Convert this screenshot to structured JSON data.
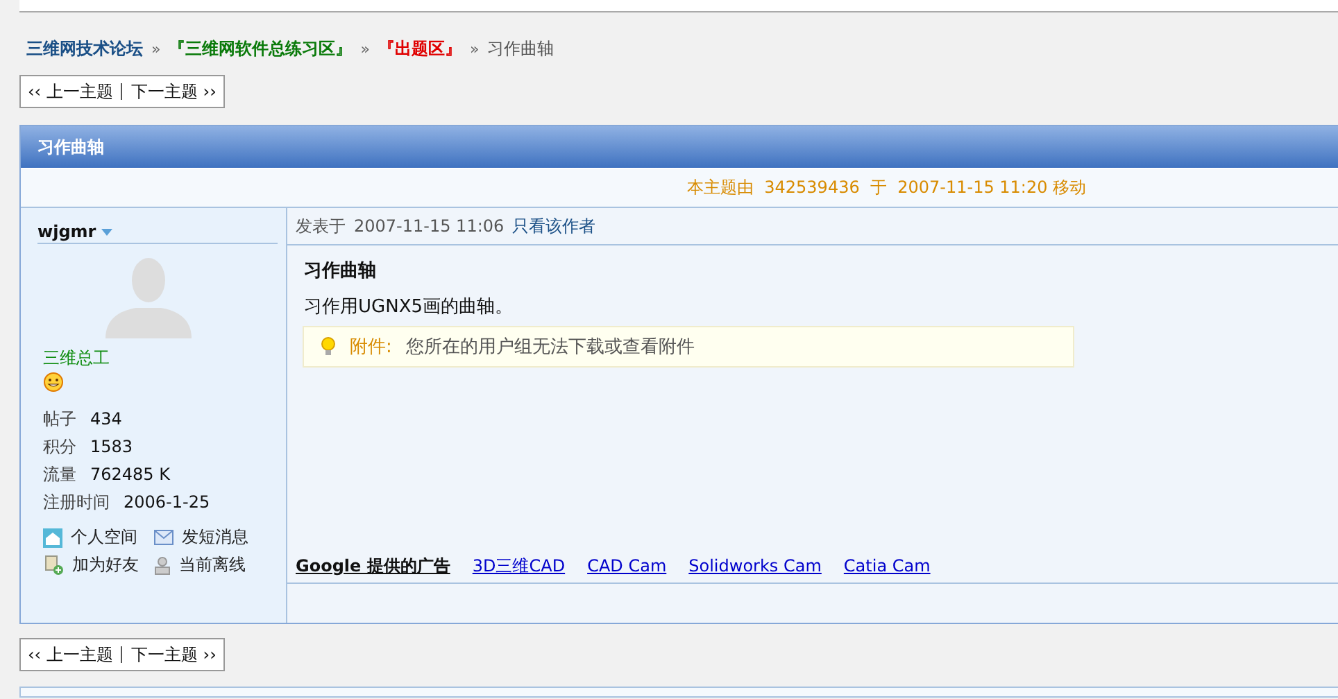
{
  "breadcrumb": [
    {
      "label": "三维网技术论坛",
      "color": "#1a4f86"
    },
    {
      "label": "『三维网软件总练习区』",
      "color": "#0a7a0a"
    },
    {
      "label": "『出题区』",
      "color": "#e00000"
    },
    {
      "label": "习作曲轴",
      "color": "#555555"
    }
  ],
  "breadcrumb_separator": "»",
  "thread_nav": {
    "prev": "上一主题",
    "next": "下一主题",
    "prev_arrow": "‹‹",
    "next_arrow": "››"
  },
  "thread_nav_bottom": {
    "prev": "上一主题",
    "next": "下一主题",
    "prev_arrow": "‹‹",
    "next_arrow": "››"
  },
  "thread": {
    "title": "习作曲轴",
    "move_notice": "本主题由  342539436  于  2007-11-15 11:20 移动"
  },
  "post": {
    "author": "wjgmr",
    "rank": "三维总工",
    "stats": [
      {
        "label": "帖子",
        "value": "434"
      },
      {
        "label": "积分",
        "value": "1583"
      },
      {
        "label": "流量",
        "value": "762485 K"
      },
      {
        "label": "注册时间",
        "value": "2006-1-25"
      }
    ],
    "actions": [
      {
        "kind": "home",
        "label": "个人空间"
      },
      {
        "kind": "mail",
        "label": "发短消息"
      },
      {
        "kind": "add",
        "label": "加为好友"
      },
      {
        "kind": "offline",
        "label": "当前离线"
      }
    ],
    "posted_label": "发表于",
    "posted_time": "2007-11-15 11:06",
    "only_author": "只看该作者",
    "subject": "习作曲轴",
    "body": "习作用UGNX5画的曲轴。",
    "attachment_label": "附件:",
    "attachment_text": "您所在的用户组无法下载或查看附件"
  },
  "ads": {
    "label": "Google 提供的广告",
    "links": [
      "3D三维CAD",
      "CAD Cam",
      "Solidworks Cam",
      "Catia Cam"
    ]
  }
}
